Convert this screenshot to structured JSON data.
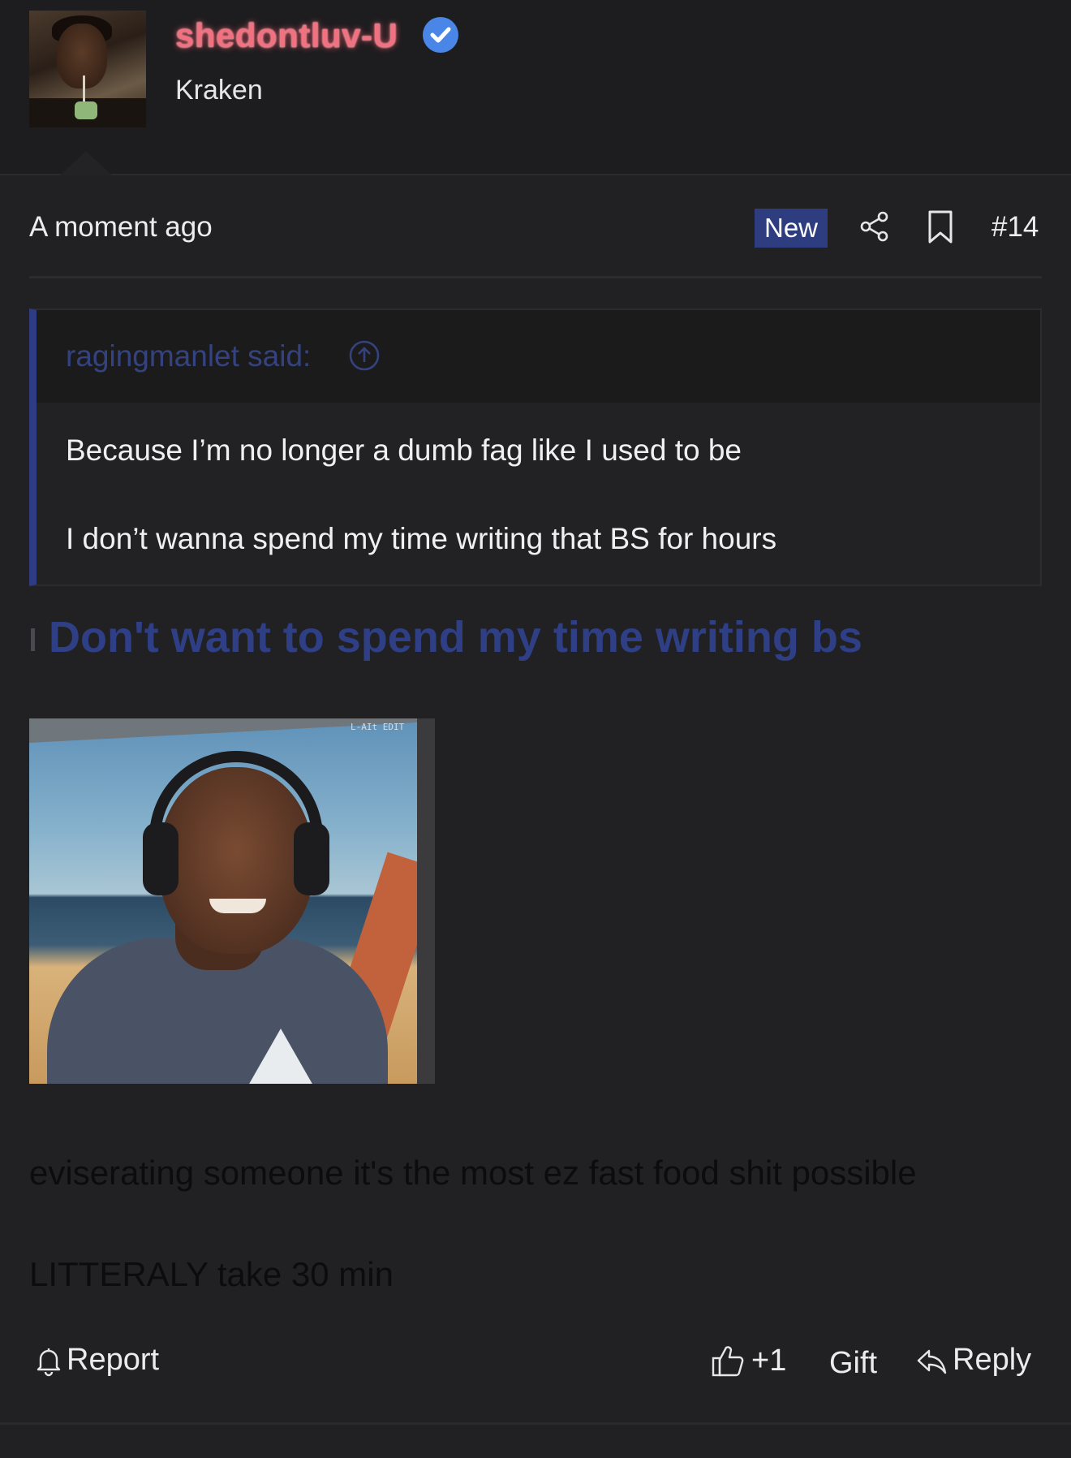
{
  "user": {
    "username": "shedontluv-U",
    "title": "Kraken",
    "verified": true
  },
  "post": {
    "timestamp": "A moment ago",
    "badge": "New",
    "number": "#14"
  },
  "quote": {
    "author": "ragingmanlet said:",
    "lines": [
      "Because I’m no longer a dumb fag like I used to be",
      "I don’t wanna spend my time writing that BS for hours"
    ]
  },
  "headline": "Don't want to spend my time writing bs",
  "image": {
    "watermark": "L-AIt EDIT"
  },
  "body": {
    "lines": [
      "eviserating someone it's the most ez fast food shit possible",
      "LITTERALY take 30 min"
    ]
  },
  "footer": {
    "report_label": "Report",
    "like_label": "+1",
    "gift_label": "Gift",
    "reply_label": "Reply"
  },
  "colors": {
    "accent": "#2d3d7f",
    "username": "#f07280",
    "verified": "#4a86e8"
  }
}
